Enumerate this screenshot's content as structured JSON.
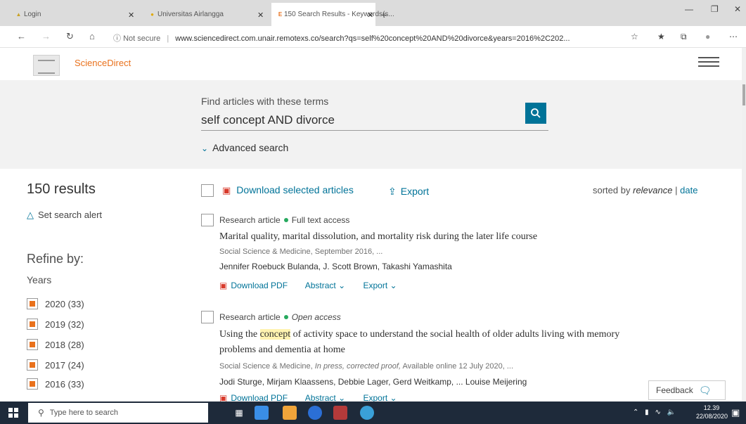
{
  "browser": {
    "tabs": [
      {
        "label": "Login",
        "icon": "login-tab-icon"
      },
      {
        "label": "Universitas Airlangga",
        "icon": "unair-tab-icon"
      },
      {
        "label": "150 Search Results - Keywords(s...",
        "icon": "elsevier-tab-icon"
      }
    ],
    "new_tab": "+",
    "url_prefix": "Not secure",
    "url": "www.sciencedirect.com.unair.remotexs.co/search?qs=self%20concept%20AND%20divorce&years=2016%2C202..."
  },
  "site": {
    "brand": "ScienceDirect"
  },
  "search": {
    "label": "Find articles with these terms",
    "query": "self concept AND divorce",
    "advanced": "Advanced search"
  },
  "sidebar": {
    "results_count": "150 results",
    "set_alert": "Set search alert",
    "refine": "Refine by:",
    "years_label": "Years",
    "years": [
      {
        "label": "2020 (33)"
      },
      {
        "label": "2019 (32)"
      },
      {
        "label": "2018 (28)"
      },
      {
        "label": "2017 (24)"
      },
      {
        "label": "2016 (33)"
      }
    ]
  },
  "toolbar": {
    "download_selected": "Download selected articles",
    "export": "Export",
    "sorted_by": "sorted by",
    "relevance": "relevance",
    "sep": "|",
    "date": "date"
  },
  "results": [
    {
      "type": "Research article",
      "access": "Full text access",
      "title": "Marital quality, marital dissolution, and mortality risk during the later life course",
      "source": "Social Science & Medicine, September 2016, ...",
      "authors": "Jennifer Roebuck Bulanda, J. Scott Brown, Takashi Yamashita",
      "download_pdf": "Download PDF",
      "abstract": "Abstract",
      "export": "Export"
    },
    {
      "type": "Research article",
      "access": "Open access",
      "title_before": "Using the ",
      "title_highlight": "concept",
      "title_after": " of activity space to understand the social health of older adults living with memory",
      "title_line2": "problems and dementia at home",
      "source_a": "Social Science & Medicine, ",
      "source_b": "In press, corrected proof,",
      "source_c": " Available online 12 July 2020, ...",
      "authors": "Jodi Sturge, Mirjam Klaassens, Debbie Lager, Gerd Weitkamp, ... Louise Meijering",
      "download_pdf": "Download PDF",
      "abstract": "Abstract",
      "export": "Export"
    }
  ],
  "feedback": "Feedback",
  "taskbar": {
    "search_placeholder": "Type here to search",
    "time": "12.39",
    "date": "22/08/2020"
  }
}
